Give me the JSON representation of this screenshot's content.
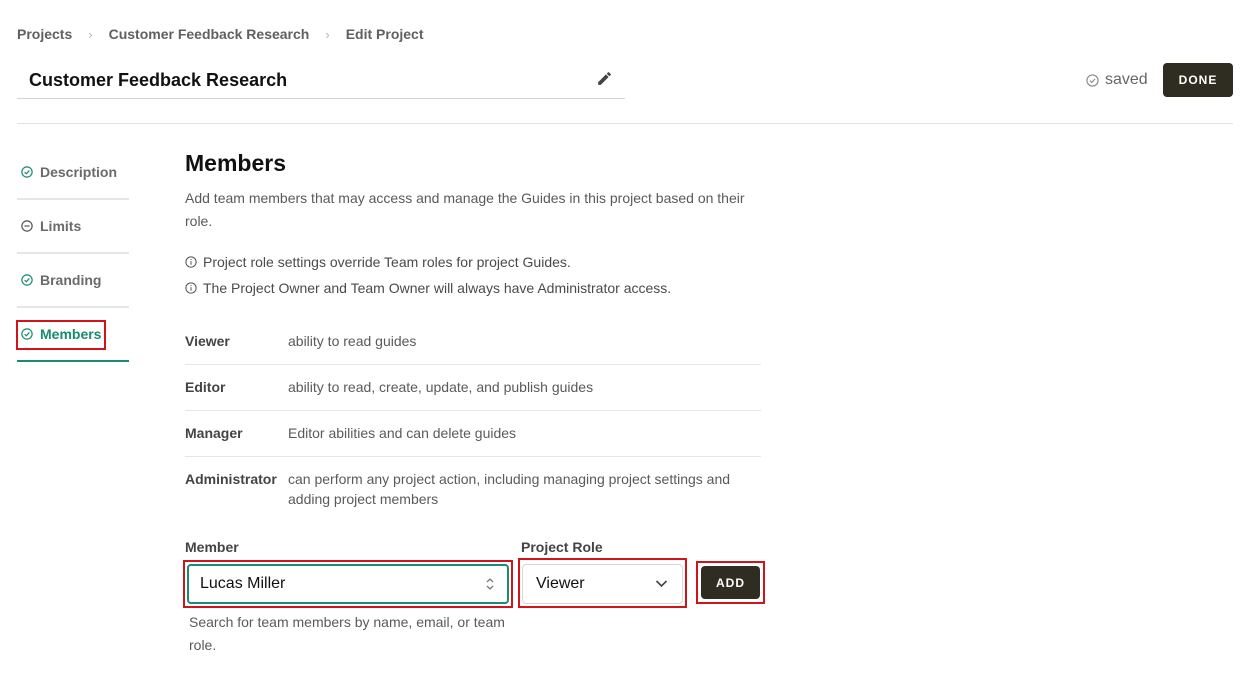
{
  "breadcrumb": {
    "items": [
      "Projects",
      "Customer Feedback Research",
      "Edit Project"
    ],
    "separator": "›"
  },
  "header": {
    "project_title": "Customer Feedback Research",
    "status": "saved",
    "done_label": "DONE"
  },
  "sidebar": {
    "items": [
      {
        "label": "Description",
        "icon": "check-circle-icon"
      },
      {
        "label": "Limits",
        "icon": "minus-circle-icon"
      },
      {
        "label": "Branding",
        "icon": "check-circle-icon"
      },
      {
        "label": "Members",
        "icon": "check-circle-icon",
        "active": true
      }
    ]
  },
  "main": {
    "heading": "Members",
    "intro": "Add team members that may access and manage the Guides in this project based on their role.",
    "notes": [
      "Project role settings override Team roles for project Guides.",
      "The Project Owner and Team Owner will always have Administrator access."
    ],
    "roles": [
      {
        "name": "Viewer",
        "desc": "ability to read guides"
      },
      {
        "name": "Editor",
        "desc": "ability to read, create, update, and publish guides"
      },
      {
        "name": "Manager",
        "desc": "Editor abilities and can delete guides"
      },
      {
        "name": "Administrator",
        "desc": "can perform any project action, including managing project settings and adding project members"
      }
    ]
  },
  "form": {
    "member_label": "Member",
    "member_value": "Lucas Miller",
    "role_label": "Project Role",
    "role_value": "Viewer",
    "add_label": "ADD",
    "helper": "Search for team members by name, email, or team role."
  },
  "colors": {
    "accent": "#1a8a70",
    "dark_button": "#2f2c22",
    "highlight": "#d0141b"
  }
}
